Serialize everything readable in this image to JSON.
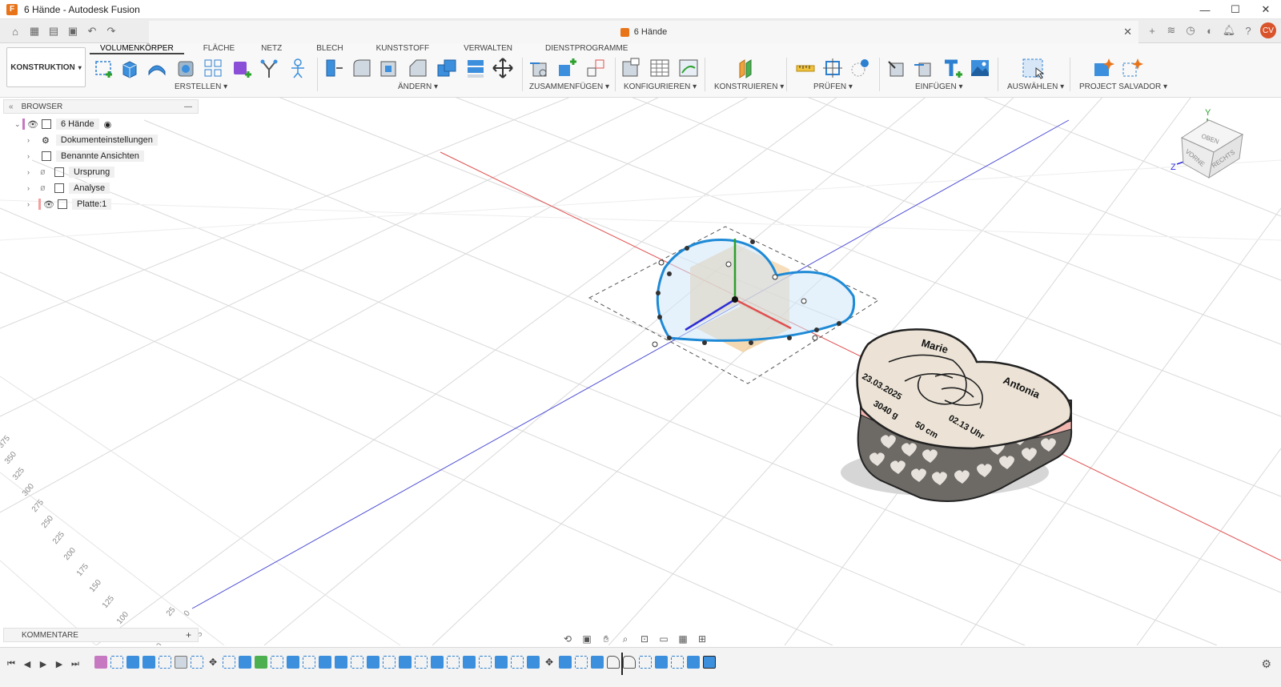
{
  "window": {
    "title": "6 Hände - Autodesk Fusion",
    "controls": [
      "—",
      "☐",
      "✕"
    ]
  },
  "tabbar": {
    "document_tab": "6 Hände",
    "close": "✕",
    "avatar": "CV"
  },
  "ribbon": {
    "workspace": "KONSTRUKTION",
    "tabs": [
      "VOLUMENKÖRPER",
      "FLÄCHE",
      "NETZ",
      "BLECH",
      "KUNSTSTOFF",
      "VERWALTEN",
      "DIENSTPROGRAMME"
    ],
    "active_tab": "VOLUMENKÖRPER",
    "groups": {
      "erstellen": "ERSTELLEN",
      "aendern": "ÄNDERN",
      "zusammenfuegen": "ZUSAMMENFÜGEN",
      "konfigurieren": "KONFIGURIEREN",
      "konstruieren": "KONSTRUIEREN",
      "pruefen": "PRÜFEN",
      "einfuegen": "EINFÜGEN",
      "auswaehlen": "AUSWÄHLEN",
      "project_salvador": "PROJECT SALVADOR"
    }
  },
  "browser": {
    "title": "BROWSER",
    "root": "6 Hände",
    "items": [
      {
        "label": "Dokumenteinstellungen",
        "icon": "gear-icon"
      },
      {
        "label": "Benannte Ansichten",
        "icon": "folder-icon"
      },
      {
        "label": "Ursprung",
        "icon": "folder-icon"
      },
      {
        "label": "Analyse",
        "icon": "folder-icon"
      },
      {
        "label": "Platte:1",
        "icon": "component-icon"
      }
    ]
  },
  "comments": {
    "title": "KOMMENTARE",
    "plus": "+"
  },
  "viewcube": {
    "top": "OBEN",
    "front": "VORNE",
    "right": "RECHTS",
    "axis_y": "Y",
    "axis_z": "Z"
  },
  "model": {
    "text_name1": "Marie",
    "text_name2": "Antonia",
    "text_date": "23.03.2025",
    "text_weight": "3040 g",
    "text_time": "02.13 Uhr",
    "text_length": "50 cm"
  },
  "ruler": {
    "labels": [
      "375",
      "350",
      "325",
      "300",
      "275",
      "250",
      "225",
      "200",
      "175",
      "150",
      "125",
      "100",
      "75",
      "50",
      "25",
      "0"
    ],
    "bottom": [
      "75",
      "50"
    ]
  },
  "colors": {
    "accent_orange": "#e8741a",
    "sketch_blue": "#1e8ad6",
    "axis_red": "#e05050",
    "axis_blue": "#4d4dd6",
    "avatar": "#d9532b"
  }
}
